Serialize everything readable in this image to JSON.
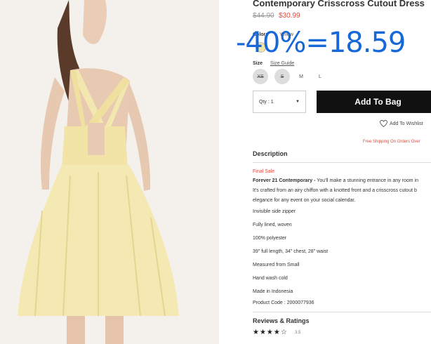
{
  "product": {
    "title": "Contemporary Crisscross Cutout Dress",
    "original_price": "$44.90",
    "sale_price": "$30.99",
    "discount_overlay": "-40%=18.59"
  },
  "color": {
    "label": "Color:",
    "value": "Yellow",
    "swatch": "#f1e69f"
  },
  "size": {
    "label": "Size",
    "guide_link": "Size Guide",
    "options": [
      {
        "label": "XS",
        "available": false
      },
      {
        "label": "S",
        "available": false
      },
      {
        "label": "M",
        "available": true
      },
      {
        "label": "L",
        "available": true
      }
    ]
  },
  "purchase": {
    "qty_label": "Qty : 1",
    "add_to_bag": "Add To Bag",
    "wishlist": "Add To Wishlist",
    "shipping": "Free Shipping On Orders Over"
  },
  "description": {
    "heading": "Description",
    "final_sale": "Final Sale",
    "intro_bold": "Forever 21 Contemporary -",
    "intro_line1": " You'll make a stunning entrance in any room in",
    "intro_line2": "It's crafted from an airy chiffon with a knotted front and a crisscross cutout b",
    "intro_line3": "elegance for any event on your social calendar.",
    "bullets": [
      "Invisible side zipper",
      "Fully lined, woven",
      "100% polyester",
      "39\" full length, 34\" chest, 28\" waist",
      "Measured from Small",
      "Hand wash cold",
      "Made in Indonesia",
      "Product Code : 2000077936"
    ]
  },
  "reviews": {
    "heading": "Reviews & Ratings",
    "stars": "★★★★☆",
    "rating": "3.5"
  },
  "colors": {
    "accent_red": "#e04a3c",
    "overlay_blue": "#1668d8",
    "button_black": "#111111"
  }
}
